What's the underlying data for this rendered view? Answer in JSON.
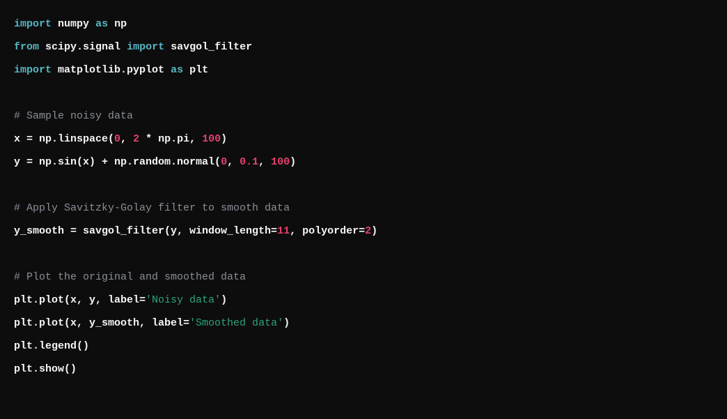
{
  "code": {
    "lines": [
      {
        "type": "import",
        "tokens": [
          "import",
          " ",
          "numpy",
          " ",
          "as",
          " ",
          "np"
        ],
        "classes": [
          "kw",
          "",
          "mod",
          "",
          "kw",
          "",
          "mod"
        ]
      },
      {
        "type": "import",
        "tokens": [
          "from",
          " ",
          "scipy.signal",
          " ",
          "import",
          " ",
          "savgol_filter"
        ],
        "classes": [
          "kw",
          "",
          "mod",
          "",
          "kw",
          "",
          "mod"
        ]
      },
      {
        "type": "import",
        "tokens": [
          "import",
          " ",
          "matplotlib.pyplot",
          " ",
          "as",
          " ",
          "plt"
        ],
        "classes": [
          "kw",
          "",
          "mod",
          "",
          "kw",
          "",
          "mod"
        ]
      },
      {
        "type": "blank"
      },
      {
        "type": "comment",
        "text": "# Sample noisy data"
      },
      {
        "type": "code",
        "tokens": [
          "x = np.linspace(",
          "0",
          ", ",
          "2",
          " * np.pi, ",
          "100",
          ")"
        ],
        "classes": [
          "",
          "num",
          "",
          "num",
          "",
          "num",
          ""
        ]
      },
      {
        "type": "code",
        "tokens": [
          "y = np.sin(x) + np.random.normal(",
          "0",
          ", ",
          "0.1",
          ", ",
          "100",
          ")"
        ],
        "classes": [
          "",
          "num",
          "",
          "num",
          "",
          "num",
          ""
        ]
      },
      {
        "type": "blank"
      },
      {
        "type": "comment",
        "text": "# Apply Savitzky-Golay filter to smooth data"
      },
      {
        "type": "code",
        "tokens": [
          "y_smooth = savgol_filter(y, window_length=",
          "11",
          ", polyorder=",
          "2",
          ")"
        ],
        "classes": [
          "",
          "num",
          "",
          "num",
          ""
        ]
      },
      {
        "type": "blank"
      },
      {
        "type": "comment",
        "text": "# Plot the original and smoothed data"
      },
      {
        "type": "code",
        "tokens": [
          "plt.plot(x, y, label=",
          "'Noisy data'",
          ")"
        ],
        "classes": [
          "",
          "str",
          ""
        ]
      },
      {
        "type": "code",
        "tokens": [
          "plt.plot(x, y_smooth, label=",
          "'Smoothed data'",
          ")"
        ],
        "classes": [
          "",
          "str",
          ""
        ]
      },
      {
        "type": "code",
        "tokens": [
          "plt.legend()"
        ],
        "classes": [
          ""
        ]
      },
      {
        "type": "code",
        "tokens": [
          "plt.show()"
        ],
        "classes": [
          ""
        ]
      }
    ]
  }
}
